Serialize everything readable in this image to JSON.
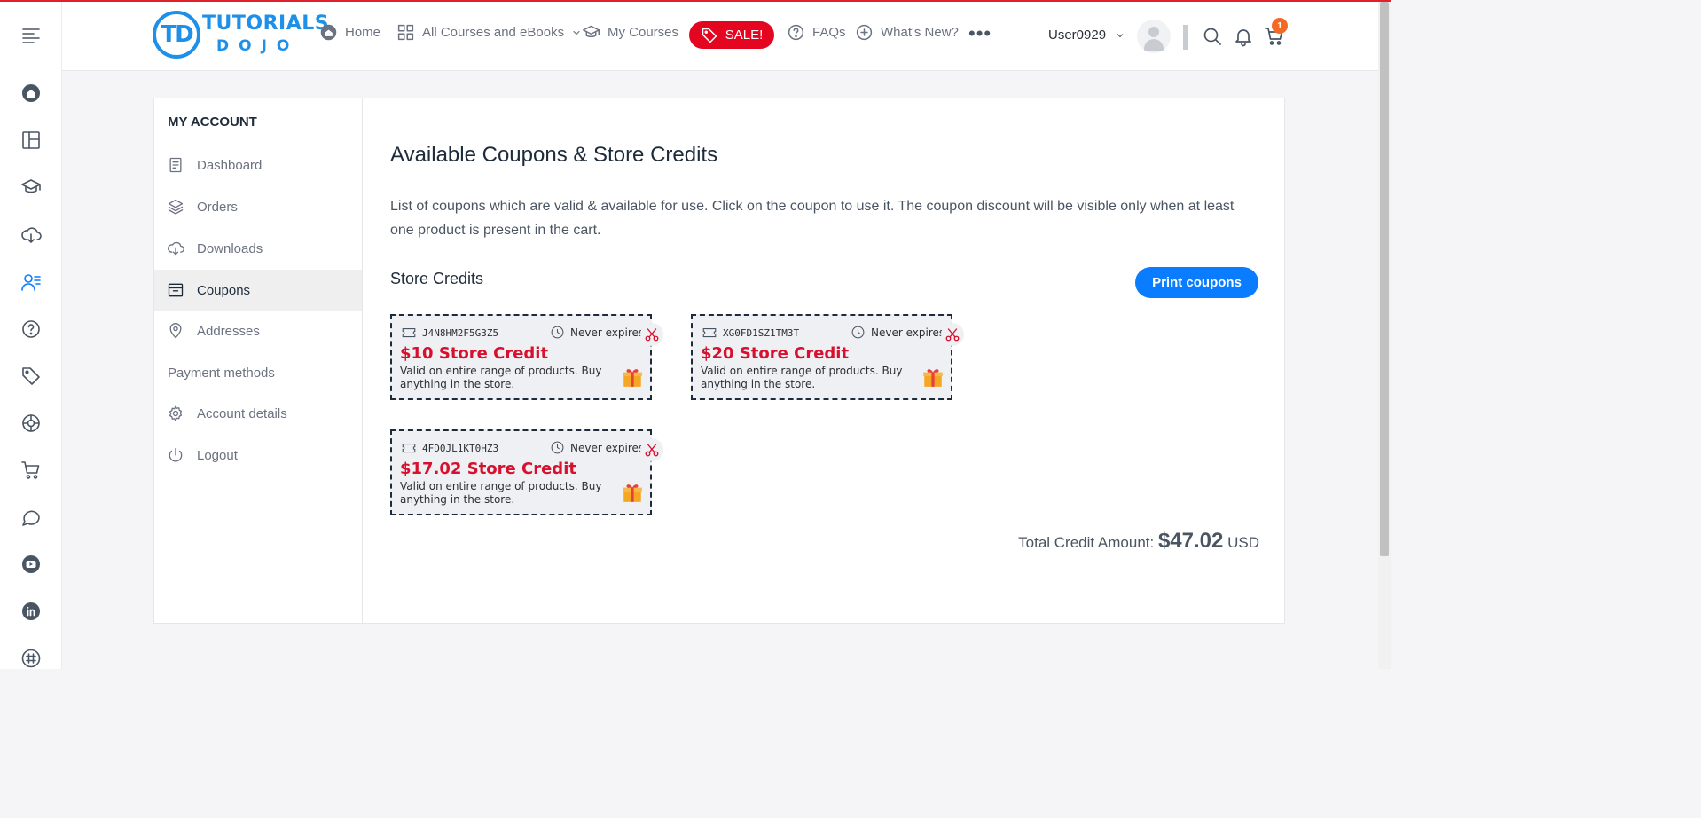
{
  "header": {
    "logo_line1": "TUTORIALS",
    "logo_line2": "DOJO",
    "logo_mark": "TD",
    "nav": {
      "home": "Home",
      "all_courses": "All Courses and eBooks",
      "my_courses": "My Courses",
      "sale": "SALE!",
      "faqs": "FAQs",
      "whats_new": "What's New?"
    },
    "username": "User0929",
    "cart_count": "1"
  },
  "sidebar": {
    "heading": "MY ACCOUNT",
    "items": [
      {
        "label": "Dashboard"
      },
      {
        "label": "Orders"
      },
      {
        "label": "Downloads"
      },
      {
        "label": "Coupons"
      },
      {
        "label": "Addresses"
      },
      {
        "label": "Payment methods"
      },
      {
        "label": "Account details"
      },
      {
        "label": "Logout"
      }
    ],
    "active": "Coupons"
  },
  "main": {
    "title": "Available Coupons & Store Credits",
    "description": "List of coupons which are valid & available for use. Click on the coupon to use it. The coupon discount will be visible only when at least one product is present in the cart.",
    "section_title": "Store Credits",
    "print_button": "Print coupons",
    "coupons": [
      {
        "code": "J4N8HM2F5G3Z5",
        "expiry": "Never expires",
        "amount": "$10 Store Credit",
        "description": "Valid on entire range of products. Buy anything in the store."
      },
      {
        "code": "XG0FD1SZ1TM3T",
        "expiry": "Never expires",
        "amount": "$20 Store Credit",
        "description": "Valid on entire range of products. Buy anything in the store."
      },
      {
        "code": "4FD0JL1KT0HZ3",
        "expiry": "Never expires",
        "amount": "$17.02 Store Credit",
        "description": "Valid on entire range of products. Buy anything in the store."
      }
    ],
    "total_label": "Total Credit Amount:",
    "total_amount": "$47.02",
    "total_currency": "USD"
  },
  "colors": {
    "accent": "#0a7cff",
    "sale": "#e40521",
    "credit_red": "#d6102d",
    "logo_blue": "#1e90e8",
    "badge": "#f46a25"
  }
}
